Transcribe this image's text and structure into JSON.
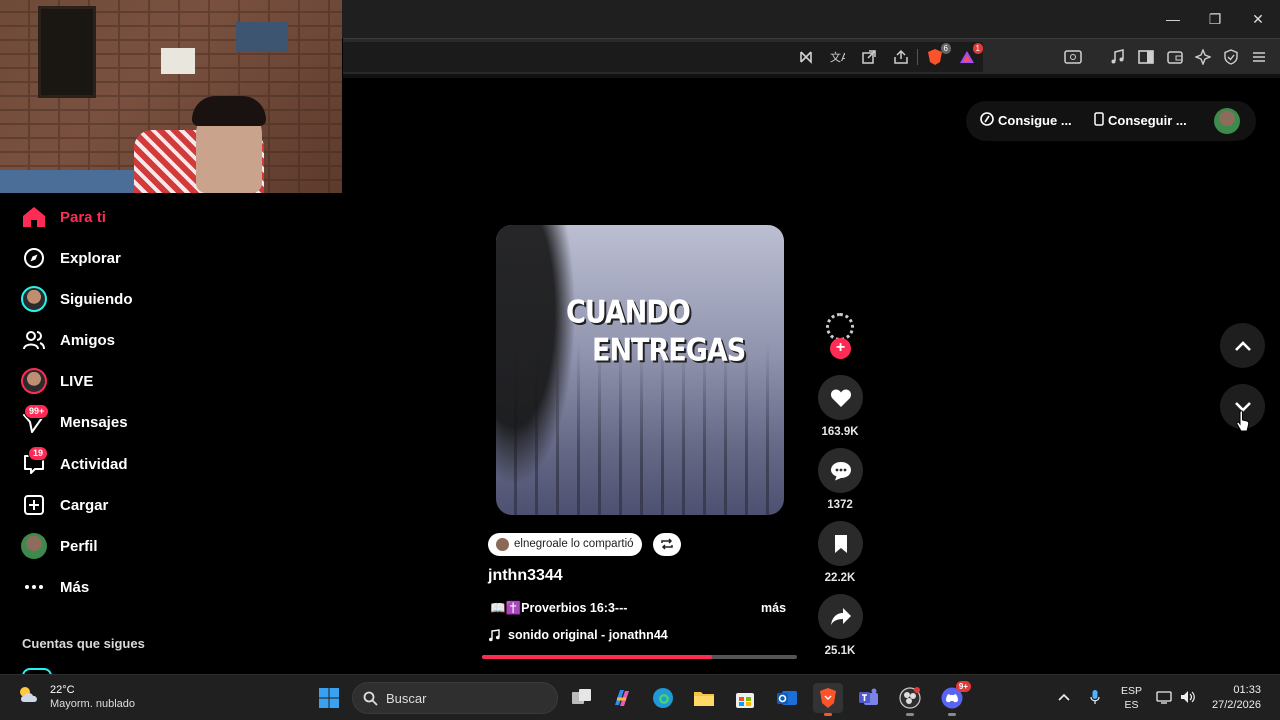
{
  "window": {
    "minimize": "—",
    "restore": "❐",
    "close": "✕"
  },
  "toolbar": {
    "brave_shield_count": "6",
    "rewards_count": "1"
  },
  "topbar": {
    "pill_coins": "Consigue ...",
    "pill_app": "Conseguir ..."
  },
  "sidebar": {
    "items": [
      {
        "label": "Para ti",
        "icon": "home-icon",
        "active": true
      },
      {
        "label": "Explorar",
        "icon": "compass-icon"
      },
      {
        "label": "Siguiendo",
        "icon": "following-avatar-icon"
      },
      {
        "label": "Amigos",
        "icon": "friends-icon"
      },
      {
        "label": "LIVE",
        "icon": "live-avatar-icon"
      },
      {
        "label": "Mensajes",
        "icon": "messages-icon",
        "badge": "99+"
      },
      {
        "label": "Actividad",
        "icon": "activity-icon",
        "badge": "19"
      },
      {
        "label": "Cargar",
        "icon": "upload-icon"
      },
      {
        "label": "Perfil",
        "icon": "profile-avatar-icon"
      },
      {
        "label": "Más",
        "icon": "more-icon"
      }
    ],
    "following_title": "Cuentas que sigues"
  },
  "video": {
    "caption_line1": "CUANDO",
    "caption_line2": "ENTREGAS",
    "shared_by": "elnegroale lo compartió",
    "author": "jnthn3344",
    "description": "📖✝️Proverbios 16:3---",
    "more": "más",
    "sound": "sonido original - jonathn44",
    "progress_fraction": 0.73
  },
  "actions": {
    "likes": "163.9K",
    "comments": "1372",
    "saves": "22.2K",
    "shares": "25.1K"
  },
  "taskbar": {
    "weather_temp": "22°C",
    "weather_desc": "Mayorm. nublado",
    "search_placeholder": "Buscar",
    "discord_badge": "9+",
    "lang_top": "ESP",
    "lang_bottom": "ES",
    "time": "01:33",
    "date": "27/2/2026"
  },
  "colors": {
    "accent": "#fe2c55",
    "cyan": "#25f4ee",
    "background": "#000000"
  }
}
